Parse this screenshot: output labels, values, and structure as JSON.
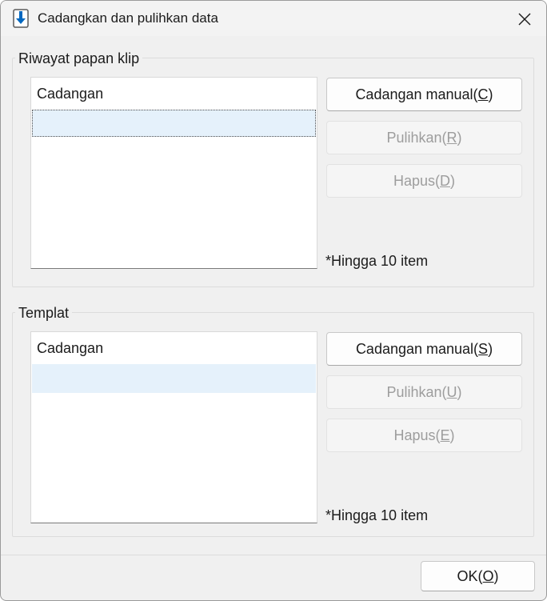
{
  "window": {
    "title": "Cadangkan dan pulihkan data",
    "icon": "download-arrow-icon"
  },
  "clipboard_history": {
    "group_label": "Riwayat papan klip",
    "list_header": "Cadangan",
    "backup_button": {
      "label": "Cadangan manual(",
      "key": "C",
      "close": ")"
    },
    "restore_button": {
      "label": "Pulihkan(",
      "key": "R",
      "close": ")"
    },
    "delete_button": {
      "label": "Hapus(",
      "key": "D",
      "close": ")"
    },
    "note": "*Hingga 10 item"
  },
  "template": {
    "group_label": "Templat",
    "list_header": "Cadangan",
    "backup_button": {
      "label": "Cadangan manual(",
      "key": "S",
      "close": ")"
    },
    "restore_button": {
      "label": "Pulihkan(",
      "key": "U",
      "close": ")"
    },
    "delete_button": {
      "label": "Hapus(",
      "key": "E",
      "close": ")"
    },
    "note": "*Hingga 10 item"
  },
  "footer": {
    "ok_button": {
      "label": "OK(",
      "key": "O",
      "close": ")"
    }
  },
  "colors": {
    "selection": "#e5f1fb",
    "accent": "#0067c0"
  }
}
